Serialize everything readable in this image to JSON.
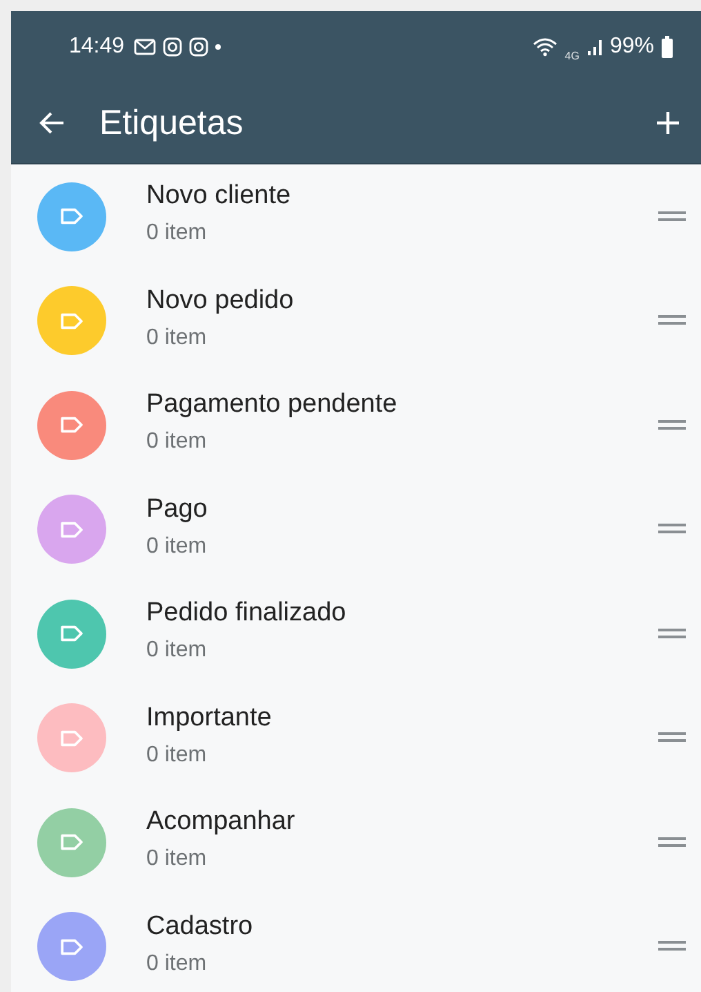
{
  "status_bar": {
    "time": "14:49",
    "network": "4G",
    "battery": "99%"
  },
  "app_bar": {
    "title": "Etiquetas"
  },
  "labels": [
    {
      "name": "Novo cliente",
      "count": "0 item",
      "color": "#5ab8f5"
    },
    {
      "name": "Novo pedido",
      "count": "0 item",
      "color": "#fdcb2c"
    },
    {
      "name": "Pagamento pendente",
      "count": "0 item",
      "color": "#f98a7c"
    },
    {
      "name": "Pago",
      "count": "0 item",
      "color": "#d9a6ee"
    },
    {
      "name": "Pedido finalizado",
      "count": "0 item",
      "color": "#4ec6ae"
    },
    {
      "name": "Importante",
      "count": "0 item",
      "color": "#fdbcc0"
    },
    {
      "name": "Acompanhar",
      "count": "0 item",
      "color": "#93cfa4"
    },
    {
      "name": "Cadastro",
      "count": "0 item",
      "color": "#9aa5f6"
    }
  ]
}
